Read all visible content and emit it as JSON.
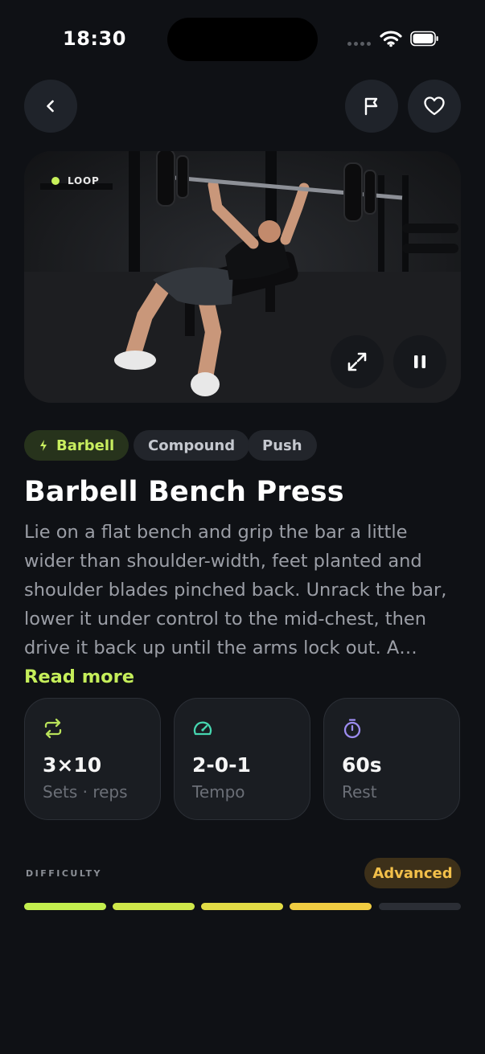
{
  "status": {
    "time": "18:30"
  },
  "header": {
    "back_icon": "chevron-left-icon",
    "flag_icon": "flag-icon",
    "heart_icon": "heart-icon"
  },
  "media": {
    "loop_label": "LOOP",
    "expand_icon": "expand-icon",
    "pause_icon": "pause-icon"
  },
  "chips": [
    {
      "label": "Barbell",
      "icon": "bolt-icon"
    },
    {
      "label": "Compound"
    },
    {
      "label": "Push"
    }
  ],
  "exercise": {
    "title": "Barbell Bench Press",
    "description": "Lie on a flat bench and grip the bar a little wider than shoulder-width, feet planted and shoulder blades pinched back. Unrack the bar, lower it under control to the mid-chest, then drive it back up until the arms lock out. A…",
    "read_more": "Read more"
  },
  "stats": [
    {
      "value": "3×10",
      "label": "Sets · reps",
      "icon": "repeat-icon",
      "color": "#b9e25a"
    },
    {
      "value": "2-0-1",
      "label": "Tempo",
      "icon": "gauge-icon",
      "color": "#46d6b0"
    },
    {
      "value": "60s",
      "label": "Rest",
      "icon": "stopwatch-icon",
      "color": "#9d8cf0"
    }
  ],
  "difficulty": {
    "label": "DIFFICULTY",
    "level": "Advanced",
    "filled": 4,
    "total": 5,
    "segment_colors": [
      "#c3ef4e",
      "#cfe84a",
      "#e2dc46",
      "#f0cc42",
      "#2b2e35"
    ]
  }
}
